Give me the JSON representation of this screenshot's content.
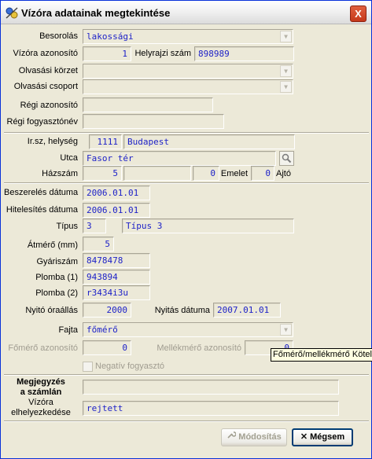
{
  "window": {
    "title": "Vízóra adatainak megtekintése",
    "close": "X"
  },
  "form": {
    "besorolas": {
      "label": "Besorolás",
      "value": "lakossági"
    },
    "vizora_azonosito": {
      "label": "Vízóra azonosító",
      "value": "1"
    },
    "helyrajzi_szam": {
      "label": "Helyrajzi szám",
      "value": "898989"
    },
    "olvasasi_korzet": {
      "label": "Olvasási körzet",
      "value": ""
    },
    "olvasasi_csoport": {
      "label": "Olvasási csoport",
      "value": ""
    },
    "regi_azonosito": {
      "label": "Régi azonosító",
      "value": ""
    },
    "regi_fogyasztonev": {
      "label": "Régi fogyasztónév",
      "value": ""
    },
    "irsz_helyseg": {
      "label": "Ir.sz, helység",
      "irsz": "1111",
      "helyseg": "Budapest"
    },
    "utca": {
      "label": "Utca",
      "value": "Fasor tér"
    },
    "hazszam": {
      "label": "Házszám",
      "value": "5",
      "extra": "",
      "emelet_value": "0",
      "emelet_label": "Emelet",
      "ajto_value": "0",
      "ajto_label": "Ajtó"
    },
    "beszereles_datuma": {
      "label": "Beszerelés dátuma",
      "value": "2006.01.01"
    },
    "hitelesites_datuma": {
      "label": "Hitelesítés dátuma",
      "value": "2006.01.01"
    },
    "tipus": {
      "label": "Típus",
      "code": "3",
      "name": "Típus 3"
    },
    "atmero": {
      "label": "Átmérő (mm)",
      "value": "5"
    },
    "gyariszam": {
      "label": "Gyáriszám",
      "value": "8478478"
    },
    "plomba1": {
      "label": "Plomba (1)",
      "value": "943894"
    },
    "plomba2": {
      "label": "Plomba (2)",
      "value": "r3434i3u"
    },
    "nyito_oraallas": {
      "label": "Nyitó óraállás",
      "value": "2000"
    },
    "nyitas_datuma": {
      "label": "Nyitás dátuma",
      "value": "2007.01.01"
    },
    "fajta": {
      "label": "Fajta",
      "value": "főmérő"
    },
    "fomero_azonosito": {
      "label": "Főmérő azonosító",
      "value": "0"
    },
    "mellekmero_azonosito": {
      "label": "Mellékmérő azonosító",
      "value": "0"
    },
    "negativ_fogyaszto": {
      "label": "Negatív fogyasztó"
    },
    "megjegyzes": {
      "label_line1": "Megjegyzés",
      "label_line2": "a számlán",
      "value": ""
    },
    "vizora_elhelyezkedese": {
      "label_line1": "Vízóra",
      "label_line2": "elhelyezkedése",
      "value": "rejtett"
    }
  },
  "buttons": {
    "modositas": "Módosítás",
    "megsem": "Mégsem"
  },
  "tooltip": {
    "text": "Főmérő/mellékmérő  Kötele"
  },
  "icons": {
    "title": "meter-icon",
    "lookup": "search-icon",
    "modositas": "wrench-icon",
    "megsem": "x-icon"
  }
}
